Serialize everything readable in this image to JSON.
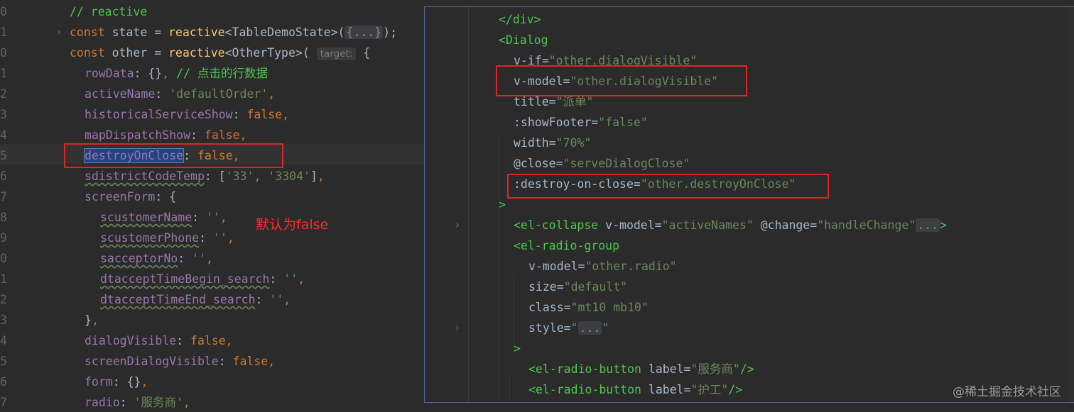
{
  "left_editor": {
    "line_numbers": [
      "0",
      "1",
      "0",
      "1",
      "2",
      "3",
      "4",
      "5",
      "6",
      "7",
      "8",
      "9",
      "0",
      "1",
      "2",
      "3",
      "4",
      "5",
      "6",
      "7"
    ],
    "lines": [
      {
        "indent": 98,
        "tokens": [
          [
            "cmt",
            "// reactive"
          ]
        ]
      },
      {
        "indent": 98,
        "tokens": [
          [
            "kw",
            "const "
          ],
          [
            "plain",
            "state = "
          ],
          [
            "fn",
            "reactive"
          ],
          [
            "plain",
            "<TableDemoState>("
          ],
          [
            "fold",
            "{...}"
          ],
          [
            "plain",
            ");"
          ]
        ],
        "chevron": true
      },
      {
        "indent": 98,
        "tokens": [
          [
            "kw",
            "const "
          ],
          [
            "plain",
            "other = "
          ],
          [
            "fn",
            "reactive"
          ],
          [
            "plain",
            "<OtherType>( "
          ],
          [
            "hint",
            "target:"
          ],
          [
            "plain",
            " {"
          ]
        ]
      },
      {
        "indent": 119,
        "tokens": [
          [
            "prop",
            "rowData"
          ],
          [
            "plain",
            ": {}"
          ],
          [
            "kw",
            ", "
          ],
          [
            "cmt",
            "// 点击的行数据"
          ]
        ]
      },
      {
        "indent": 119,
        "tokens": [
          [
            "prop",
            "activeName"
          ],
          [
            "plain",
            ": "
          ],
          [
            "str",
            "'defaultOrder'"
          ],
          [
            "kw",
            ","
          ]
        ]
      },
      {
        "indent": 119,
        "tokens": [
          [
            "prop",
            "historicalServiceShow"
          ],
          [
            "plain",
            ": "
          ],
          [
            "kw",
            "false,"
          ]
        ]
      },
      {
        "indent": 119,
        "tokens": [
          [
            "prop",
            "mapDispatchShow"
          ],
          [
            "plain",
            ": "
          ],
          [
            "kw",
            "false,"
          ]
        ]
      },
      {
        "indent": 119,
        "tokens": [
          [
            "sel",
            "destroyOnClose"
          ],
          [
            "plain",
            ": "
          ],
          [
            "kw",
            "false,"
          ]
        ]
      },
      {
        "indent": 119,
        "tokens": [
          [
            "propsq",
            "sdistrictCodeTemp"
          ],
          [
            "plain",
            ": ["
          ],
          [
            "str",
            "'33'"
          ],
          [
            "kw",
            ", "
          ],
          [
            "str",
            "'3304'"
          ],
          [
            "plain",
            "]"
          ],
          [
            "kw",
            ","
          ]
        ]
      },
      {
        "indent": 119,
        "tokens": [
          [
            "prop",
            "screenForm"
          ],
          [
            "plain",
            ": {"
          ]
        ]
      },
      {
        "indent": 141,
        "tokens": [
          [
            "propsq",
            "scustomerName"
          ],
          [
            "plain",
            ": "
          ],
          [
            "str",
            "''"
          ],
          [
            "kw",
            ","
          ]
        ]
      },
      {
        "indent": 141,
        "tokens": [
          [
            "propsq",
            "scustomerPhone"
          ],
          [
            "plain",
            ": "
          ],
          [
            "str",
            "''"
          ],
          [
            "kw",
            ","
          ]
        ]
      },
      {
        "indent": 141,
        "tokens": [
          [
            "propsq",
            "sacceptorNo"
          ],
          [
            "plain",
            ": "
          ],
          [
            "str",
            "''"
          ],
          [
            "kw",
            ","
          ]
        ]
      },
      {
        "indent": 141,
        "tokens": [
          [
            "propsq",
            "dtacceptTimeBegin_search"
          ],
          [
            "plain",
            ": "
          ],
          [
            "str",
            "''"
          ],
          [
            "kw",
            ","
          ]
        ]
      },
      {
        "indent": 141,
        "tokens": [
          [
            "propsq",
            "dtacceptTimeEnd_search"
          ],
          [
            "plain",
            ": "
          ],
          [
            "str",
            "''"
          ],
          [
            "kw",
            ","
          ]
        ]
      },
      {
        "indent": 119,
        "tokens": [
          [
            "plain",
            "}"
          ],
          [
            "kw",
            ","
          ]
        ]
      },
      {
        "indent": 119,
        "tokens": [
          [
            "prop",
            "dialogVisible"
          ],
          [
            "plain",
            ": "
          ],
          [
            "kw",
            "false,"
          ]
        ]
      },
      {
        "indent": 119,
        "tokens": [
          [
            "prop",
            "screenDialogVisible"
          ],
          [
            "plain",
            ": "
          ],
          [
            "kw",
            "false,"
          ]
        ]
      },
      {
        "indent": 119,
        "tokens": [
          [
            "prop",
            "form"
          ],
          [
            "plain",
            ": {}"
          ],
          [
            "kw",
            ","
          ]
        ]
      },
      {
        "indent": 119,
        "tokens": [
          [
            "prop",
            "radio"
          ],
          [
            "plain",
            ": "
          ],
          [
            "str",
            "'服务商'"
          ],
          [
            "kw",
            ","
          ]
        ]
      }
    ],
    "annotation": "默认为false"
  },
  "right_editor": {
    "lines": [
      {
        "indent": 104,
        "tokens": [
          [
            "tag",
            "</div>"
          ]
        ]
      },
      {
        "indent": 104,
        "tokens": [
          [
            "tag",
            "<Dialog"
          ]
        ]
      },
      {
        "indent": 125,
        "tokens": [
          [
            "attr",
            "v-if="
          ],
          [
            "aval",
            "\"other.dialogVisible\""
          ]
        ]
      },
      {
        "indent": 125,
        "tokens": [
          [
            "attr",
            "v-model="
          ],
          [
            "aval",
            "\"other.dialogVisible\""
          ]
        ]
      },
      {
        "indent": 125,
        "tokens": [
          [
            "attr",
            "title="
          ],
          [
            "aval",
            "\"派单\""
          ]
        ]
      },
      {
        "indent": 125,
        "tokens": [
          [
            "attr",
            ":showFooter="
          ],
          [
            "aval",
            "\"false\""
          ]
        ]
      },
      {
        "indent": 125,
        "tokens": [
          [
            "attr",
            "width="
          ],
          [
            "aval",
            "\"70%\""
          ]
        ]
      },
      {
        "indent": 125,
        "tokens": [
          [
            "attr",
            "@close="
          ],
          [
            "aval",
            "\"serveDialogClose\""
          ]
        ]
      },
      {
        "indent": 125,
        "tokens": [
          [
            "attr",
            ":destroy-on-close="
          ],
          [
            "aval",
            "\"other.destroyOnClose\""
          ]
        ]
      },
      {
        "indent": 104,
        "tokens": [
          [
            "tag",
            ">"
          ]
        ]
      },
      {
        "indent": 125,
        "tokens": [
          [
            "tag",
            "<el-collapse "
          ],
          [
            "attr",
            "v-model="
          ],
          [
            "aval",
            "\"activeNames\" "
          ],
          [
            "attr",
            "@change="
          ],
          [
            "aval",
            "\"handleChange\""
          ],
          [
            "fold",
            "..."
          ],
          [
            "tag",
            ">"
          ]
        ],
        "chevron": true
      },
      {
        "indent": 125,
        "tokens": [
          [
            "tag",
            "<el-radio-group"
          ]
        ]
      },
      {
        "indent": 146,
        "tokens": [
          [
            "attr",
            "v-model="
          ],
          [
            "aval",
            "\"other.radio\""
          ]
        ]
      },
      {
        "indent": 146,
        "tokens": [
          [
            "attr",
            "size="
          ],
          [
            "aval",
            "\"default\""
          ]
        ]
      },
      {
        "indent": 146,
        "tokens": [
          [
            "attr",
            "class="
          ],
          [
            "aval",
            "\"mt10 mb10\""
          ]
        ]
      },
      {
        "indent": 146,
        "tokens": [
          [
            "attr",
            "style="
          ],
          [
            "aval",
            "\""
          ],
          [
            "fold",
            "..."
          ],
          [
            "aval",
            "\""
          ]
        ],
        "chevron": true
      },
      {
        "indent": 125,
        "tokens": [
          [
            "tag",
            ">"
          ]
        ]
      },
      {
        "indent": 146,
        "tokens": [
          [
            "tag",
            "<el-radio-button "
          ],
          [
            "attr",
            "label="
          ],
          [
            "aval",
            "\"服务商\""
          ],
          [
            "tag",
            "/>"
          ]
        ]
      },
      {
        "indent": 146,
        "tokens": [
          [
            "tag",
            "<el-radio-button "
          ],
          [
            "attr",
            "label="
          ],
          [
            "aval",
            "\"护工\""
          ],
          [
            "tag",
            "/>"
          ]
        ]
      }
    ]
  },
  "watermark": "@稀土掘金技术社区",
  "colors": {
    "background": "#2b2b2b",
    "highlight_box": "#e02424",
    "selection": "#214283"
  }
}
